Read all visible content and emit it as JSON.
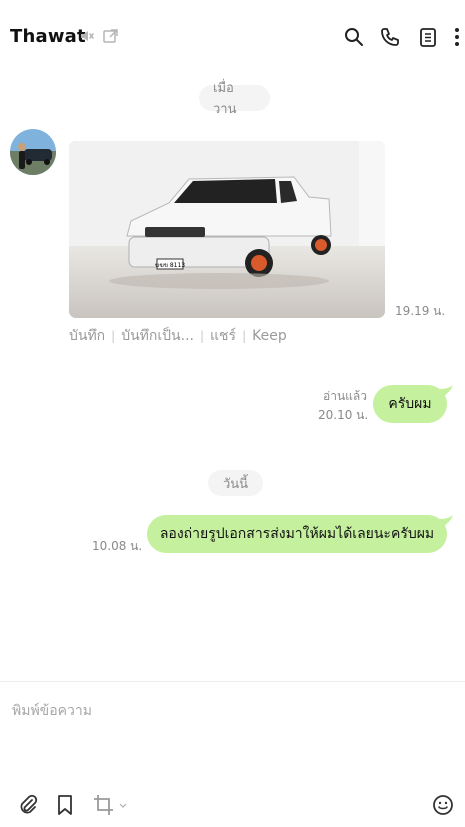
{
  "header": {
    "title": "Thawat",
    "icons": [
      "speaker-mute-icon",
      "external-window-icon",
      "search-icon",
      "phone-icon",
      "notes-icon",
      "more-vertical-icon"
    ]
  },
  "chat": {
    "date_yesterday": "เมื่อวาน",
    "date_today": "วันนี้",
    "incoming_photo": {
      "time": "19.19 น.",
      "actions": [
        "บันทึก",
        "บันทึกเป็น...",
        "แชร์",
        "Keep"
      ],
      "plate_text": "ฆฆข 8113"
    },
    "outgoing_1": {
      "read": "อ่านแล้ว",
      "time": "20.10 น.",
      "text": "ครับผม"
    },
    "outgoing_2": {
      "time": "10.08 น.",
      "text": "ลองถ่ายรูปเอกสารส่งมาให้ผมได้เลยนะครับผม"
    }
  },
  "composer": {
    "placeholder": "พิมพ์ข้อความ",
    "icons": [
      "attachment-icon",
      "bookmark-icon",
      "crop-icon",
      "emoji-icon"
    ]
  },
  "colors": {
    "bubble_out": "#c5f09e",
    "pill_bg": "#f4f4f4",
    "muted_text": "#8a8a8a"
  }
}
